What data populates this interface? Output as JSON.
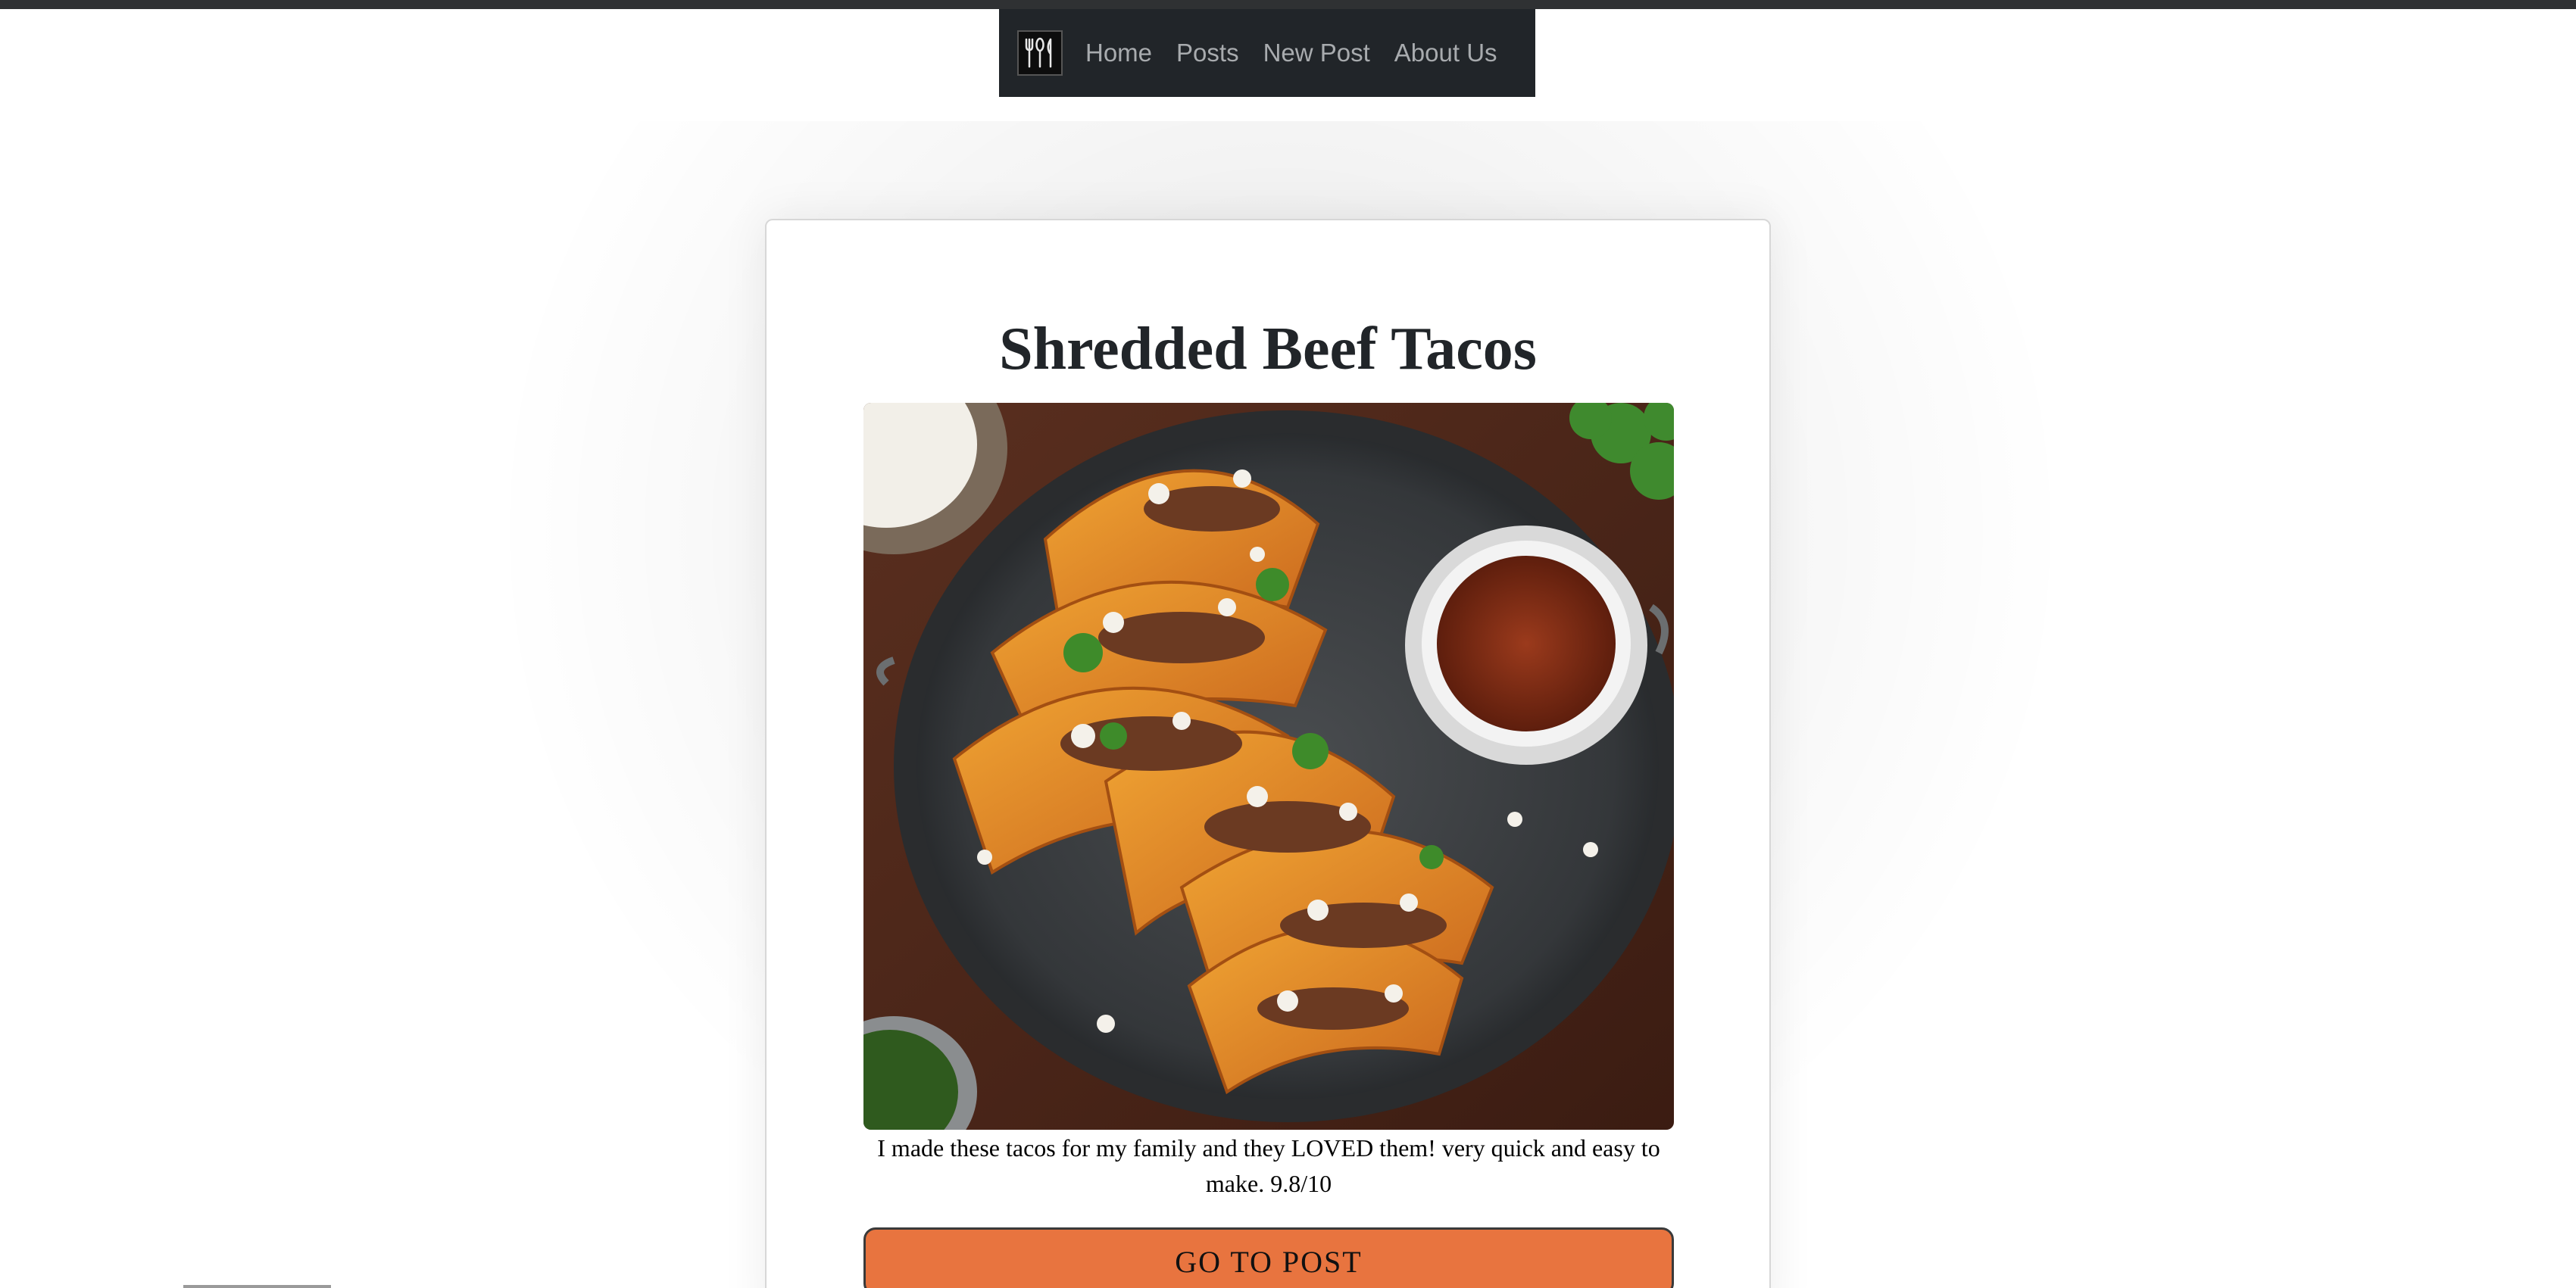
{
  "nav": {
    "logo_icon": "utensils-icon",
    "links": [
      {
        "label": "Home"
      },
      {
        "label": "Posts"
      },
      {
        "label": "New Post"
      },
      {
        "label": "About Us"
      }
    ]
  },
  "post": {
    "title": "Shredded Beef Tacos",
    "image_subject": "tacos-plate",
    "description": "I made these tacos for my family and they LOVED them! very quick and easy to make. 9.8/10",
    "button_label": "GO TO POST"
  },
  "colors": {
    "navbar_bg": "#212529",
    "nav_link": "#a8abae",
    "button_bg": "#e8743f",
    "title": "#212529"
  }
}
